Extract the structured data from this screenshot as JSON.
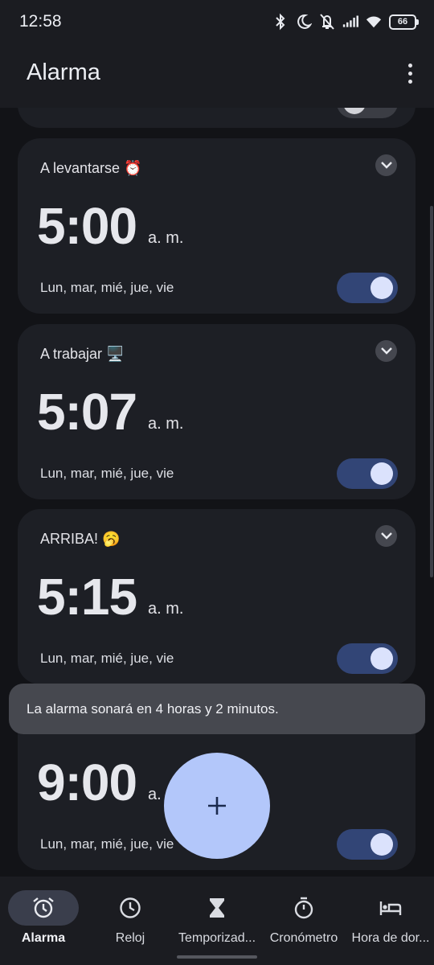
{
  "status_bar": {
    "time": "12:58",
    "battery": "66",
    "icons": [
      "bluetooth-icon",
      "do-not-disturb-moon-icon",
      "vibrate-off-icon",
      "signal-icon",
      "wifi-icon",
      "battery-icon"
    ]
  },
  "app_bar": {
    "title": "Alarma",
    "more_icon": "more-vert-icon"
  },
  "alarms": [
    {
      "label": "",
      "time": "",
      "ampm": "",
      "days": "",
      "enabled": false
    },
    {
      "label": "A levantarse ⏰",
      "time": "5:00",
      "ampm": "a. m.",
      "days": "Lun, mar, mié, jue, vie",
      "enabled": true
    },
    {
      "label": "A trabajar 🖥️",
      "time": "5:07",
      "ampm": "a. m.",
      "days": "Lun, mar, mié, jue, vie",
      "enabled": true
    },
    {
      "label": "ARRIBA! 🥱",
      "time": "5:15",
      "ampm": "a. m.",
      "days": "Lun, mar, mié, jue, vie",
      "enabled": true
    },
    {
      "label": "",
      "time": "9:00",
      "ampm": "a.",
      "days": "Lun, mar, mié, jue, vie",
      "enabled": true
    }
  ],
  "snackbar": {
    "text": "La alarma sonará en 4 horas y 2 minutos."
  },
  "fab": {
    "icon": "plus-icon"
  },
  "bottom_nav": [
    {
      "label": "Alarma",
      "icon": "alarm-icon",
      "active": true
    },
    {
      "label": "Reloj",
      "icon": "clock-icon",
      "active": false
    },
    {
      "label": "Temporizad...",
      "icon": "hourglass-icon",
      "active": false
    },
    {
      "label": "Cronómetro",
      "icon": "stopwatch-icon",
      "active": false
    },
    {
      "label": "Hora de dor...",
      "icon": "bed-icon",
      "active": false
    }
  ],
  "colors": {
    "background": "#121317",
    "card": "#1d1f25",
    "toggle_on": "#324576",
    "fab": "#b3c7fa",
    "snackbar": "#46484f"
  }
}
